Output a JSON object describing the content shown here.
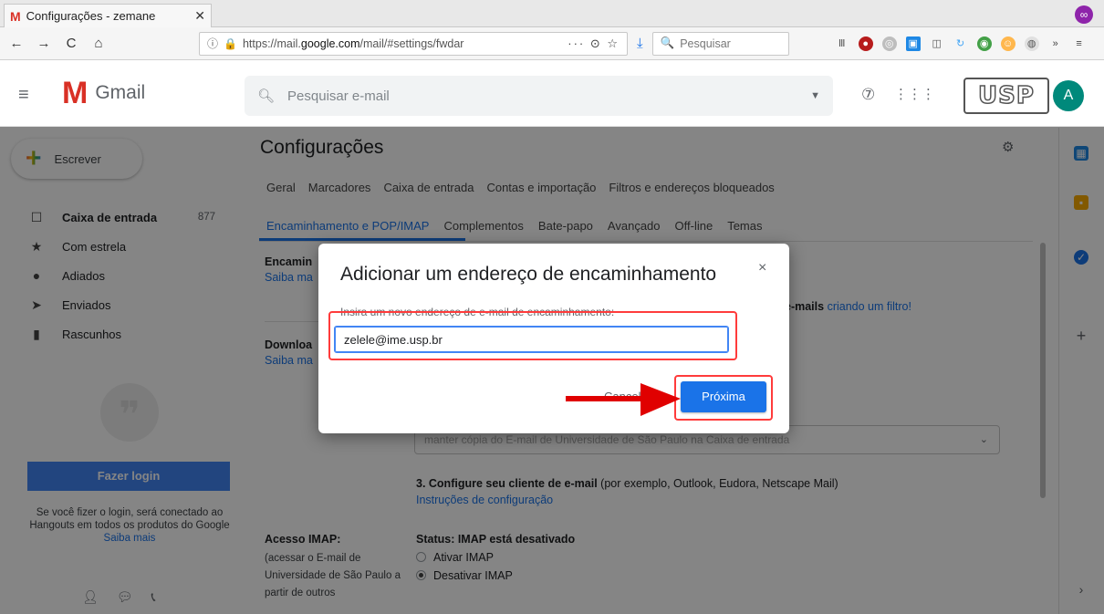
{
  "browser": {
    "tab_title": "Configurações - zemane",
    "tab_close": "✕",
    "url_prefix": "https://mail.",
    "url_domain": "google.com",
    "url_path": "/mail/#settings/fwdar",
    "url_actions": "··· ⊙ ☆",
    "search_placeholder": "Pesquisar",
    "nav_back": "←",
    "nav_forward": "→",
    "nav_reload": "C",
    "nav_home": "⌂"
  },
  "gmail": {
    "logo_text": "Gmail",
    "search_placeholder": "Pesquisar e-mail",
    "avatar_letter": "A",
    "org_logo": "USP"
  },
  "leftnav": {
    "compose_label": "Escrever",
    "items": [
      {
        "label": "Caixa de entrada",
        "count": "877"
      },
      {
        "label": "Com estrela",
        "count": ""
      },
      {
        "label": "Adiados",
        "count": ""
      },
      {
        "label": "Enviados",
        "count": ""
      },
      {
        "label": "Rascunhos",
        "count": ""
      }
    ],
    "login_button": "Fazer login",
    "hangouts_info": "Se você fizer o login, será conectado ao Hangouts em todos os produtos do Google",
    "hangouts_more": "Saiba mais"
  },
  "settings": {
    "title": "Configurações",
    "tabs_row1": [
      "Geral",
      "Marcadores",
      "Caixa de entrada",
      "Contas e importação",
      "Filtros e endereços bloqueados"
    ],
    "tabs_row2": [
      "Encaminhamento e POP/IMAP",
      "Complementos",
      "Bate-papo",
      "Avançado",
      "Off-line",
      "Temas"
    ],
    "forwarding_label": "Encamin",
    "forwarding_link": "Saiba ma",
    "filter_text": "e-mails",
    "filter_link": "criando um filtro!",
    "download_label": "Downloa",
    "download_link": "Saiba ma",
    "select_value": "manter cópia do E-mail de Universidade de São Paulo na Caixa de entrada",
    "step3_bold": "3. Configure seu cliente de e-mail",
    "step3_rest": "(por exemplo, Outlook, Eudora, Netscape Mail)",
    "step3_link": "Instruções de configuração",
    "imap_label": "Acesso IMAP:",
    "imap_desc": "(acessar o E-mail de Universidade de São Paulo a partir de outros",
    "imap_status": "Status: IMAP está desativado",
    "imap_on": "Ativar IMAP",
    "imap_off": "Desativar IMAP"
  },
  "dialog": {
    "title": "Adicionar um endereço de encaminhamento",
    "close": "×",
    "label": "Insira um novo endereço de e-mail de encaminhamento:",
    "input_value": "zelele@ime.usp.br",
    "cancel": "Cancelar",
    "next": "Próxima"
  },
  "colors": {
    "accent": "#1a73e8",
    "highlight": "#ff3b3b",
    "gmail_red": "#d93025"
  }
}
